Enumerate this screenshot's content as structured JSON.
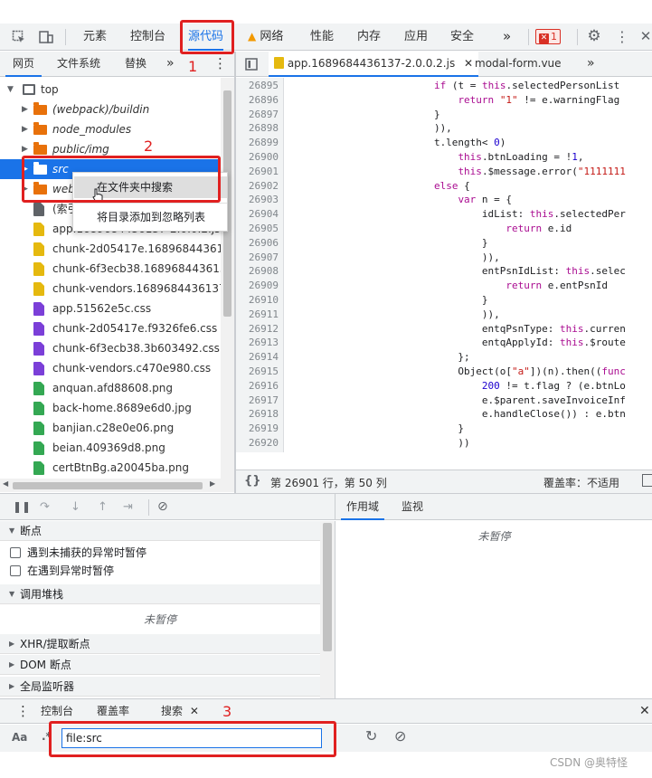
{
  "toolbar": {
    "tabs": [
      "元素",
      "控制台",
      "源代码",
      "网络",
      "性能",
      "内存",
      "应用",
      "安全"
    ],
    "more": "»",
    "error_count": "1"
  },
  "navigator": {
    "tabs": [
      "网页",
      "文件系统",
      "替换"
    ],
    "more": "»"
  },
  "tree": [
    {
      "label": "top",
      "kind": "page",
      "depth": 0,
      "open": true
    },
    {
      "label": "(webpack)/buildin",
      "kind": "folder",
      "depth": 1,
      "italic": true
    },
    {
      "label": "node_modules",
      "kind": "folder",
      "depth": 1,
      "italic": true
    },
    {
      "label": "public/img",
      "kind": "folder",
      "depth": 1,
      "italic": true
    },
    {
      "label": "src",
      "kind": "folder",
      "depth": 1,
      "italic": true,
      "selected": true
    },
    {
      "label": "webpack",
      "kind": "folder",
      "depth": 1,
      "italic": true
    },
    {
      "label": "(索引)",
      "kind": "grey",
      "depth": 1
    },
    {
      "label": "app.1689684436137-2.0.0.2.js",
      "kind": "js",
      "depth": 1
    },
    {
      "label": "chunk-2d05417e.1689684436137",
      "kind": "js",
      "depth": 1
    },
    {
      "label": "chunk-6f3ecb38.1689684436137",
      "kind": "js",
      "depth": 1
    },
    {
      "label": "chunk-vendors.1689684436137-",
      "kind": "js",
      "depth": 1
    },
    {
      "label": "app.51562e5c.css",
      "kind": "css",
      "depth": 1
    },
    {
      "label": "chunk-2d05417e.f9326fe6.css",
      "kind": "css",
      "depth": 1
    },
    {
      "label": "chunk-6f3ecb38.3b603492.css",
      "kind": "css",
      "depth": 1
    },
    {
      "label": "chunk-vendors.c470e980.css",
      "kind": "css",
      "depth": 1
    },
    {
      "label": "anquan.afd88608.png",
      "kind": "png",
      "depth": 1
    },
    {
      "label": "back-home.8689e6d0.jpg",
      "kind": "png",
      "depth": 1
    },
    {
      "label": "banjian.c28e0e06.png",
      "kind": "png",
      "depth": 1
    },
    {
      "label": "beian.409369d8.png",
      "kind": "png",
      "depth": 1
    },
    {
      "label": "certBtnBg.a20045ba.png",
      "kind": "png",
      "depth": 1
    }
  ],
  "context_menu": {
    "search_in_folder": "在文件夹中搜索",
    "add_to_ignore": "将目录添加到忽略列表"
  },
  "editor": {
    "tabs": [
      {
        "label": "app.1689684436137-2.0.0.2.js",
        "active": true
      },
      {
        "label": "modal-form.vue",
        "active": false
      }
    ],
    "more": "»",
    "line_start": 26895,
    "lines": [
      [
        [
          "pr",
          "                        "
        ],
        [
          "kw",
          "if"
        ],
        [
          "pr",
          " (t = "
        ],
        [
          "th",
          "this"
        ],
        [
          "pr",
          ".selectedPersonList"
        ]
      ],
      [
        [
          "pr",
          "                            "
        ],
        [
          "kw",
          "return"
        ],
        [
          "pr",
          " "
        ],
        [
          "st",
          "\"1\""
        ],
        [
          "pr",
          " != e.warningFlag"
        ]
      ],
      [
        [
          "pr",
          "                        }"
        ]
      ],
      [
        [
          "pr",
          "                        )),"
        ]
      ],
      [
        [
          "pr",
          "                        t.length< "
        ],
        [
          "nu",
          "0"
        ],
        [
          "pr",
          ")"
        ]
      ],
      [
        [
          "pr",
          "                            "
        ],
        [
          "th",
          "this"
        ],
        [
          "pr",
          ".btnLoading = !"
        ],
        [
          "nu",
          "1"
        ],
        [
          "pr",
          ","
        ]
      ],
      [
        [
          "pr",
          "                            "
        ],
        [
          "th",
          "this"
        ],
        [
          "pr",
          ".$message.error("
        ],
        [
          "st",
          "\"1111111"
        ]
      ],
      [
        [
          "pr",
          "                        "
        ],
        [
          "kw",
          "else"
        ],
        [
          "pr",
          " {"
        ]
      ],
      [
        [
          "pr",
          "                            "
        ],
        [
          "kw",
          "var"
        ],
        [
          "pr",
          " n = {"
        ]
      ],
      [
        [
          "pr",
          "                                idList: "
        ],
        [
          "th",
          "this"
        ],
        [
          "pr",
          ".selectedPer"
        ]
      ],
      [
        [
          "pr",
          "                                    "
        ],
        [
          "kw",
          "return"
        ],
        [
          "pr",
          " e.id"
        ]
      ],
      [
        [
          "pr",
          "                                }"
        ]
      ],
      [
        [
          "pr",
          "                                )),"
        ]
      ],
      [
        [
          "pr",
          "                                entPsnIdList: "
        ],
        [
          "th",
          "this"
        ],
        [
          "pr",
          ".selec"
        ]
      ],
      [
        [
          "pr",
          "                                    "
        ],
        [
          "kw",
          "return"
        ],
        [
          "pr",
          " e.entPsnId"
        ]
      ],
      [
        [
          "pr",
          "                                }"
        ]
      ],
      [
        [
          "pr",
          "                                )),"
        ]
      ],
      [
        [
          "pr",
          "                                entqPsnType: "
        ],
        [
          "th",
          "this"
        ],
        [
          "pr",
          ".curren"
        ]
      ],
      [
        [
          "pr",
          "                                entqApplyId: "
        ],
        [
          "th",
          "this"
        ],
        [
          "pr",
          ".$route"
        ]
      ],
      [
        [
          "pr",
          "                            };"
        ]
      ],
      [
        [
          "pr",
          "                            Object(o["
        ],
        [
          "st",
          "\"a\""
        ],
        [
          "pr",
          "])(n).then(("
        ],
        [
          "kw",
          "func"
        ]
      ],
      [
        [
          "pr",
          "                                "
        ],
        [
          "nu",
          "200"
        ],
        [
          "pr",
          " != t.flag ? (e.btnLo"
        ]
      ],
      [
        [
          "pr",
          "                                e.$parent.saveInvoiceInf"
        ]
      ],
      [
        [
          "pr",
          "                                e.handleClose()) : e.btn"
        ]
      ],
      [
        [
          "pr",
          "                            }"
        ]
      ],
      [
        [
          "pr",
          "                            ))"
        ]
      ]
    ],
    "status": "第 26901 行，第 50 列",
    "coverage": "覆盖率：不适用",
    "braces": "{}"
  },
  "debugger": {
    "sections": {
      "breakpoints": "断点",
      "call_stack": "调用堆栈",
      "xhr": "XHR/提取断点",
      "dom": "DOM 断点",
      "global": "全局监听器"
    },
    "cb_uncaught": "遇到未捕获的异常时暂停",
    "cb_caught": "在遇到异常时暂停",
    "not_paused": "未暂停"
  },
  "scope": {
    "tabs": [
      "作用域",
      "监视"
    ],
    "not_paused": "未暂停"
  },
  "drawer": {
    "tabs": [
      "控制台",
      "覆盖率",
      "搜索"
    ],
    "case_label": "Aa",
    "regex_label": ".*",
    "search_value": "file:src"
  },
  "annotations": [
    "1",
    "2",
    "3"
  ],
  "watermark": "CSDN @奥特怪"
}
